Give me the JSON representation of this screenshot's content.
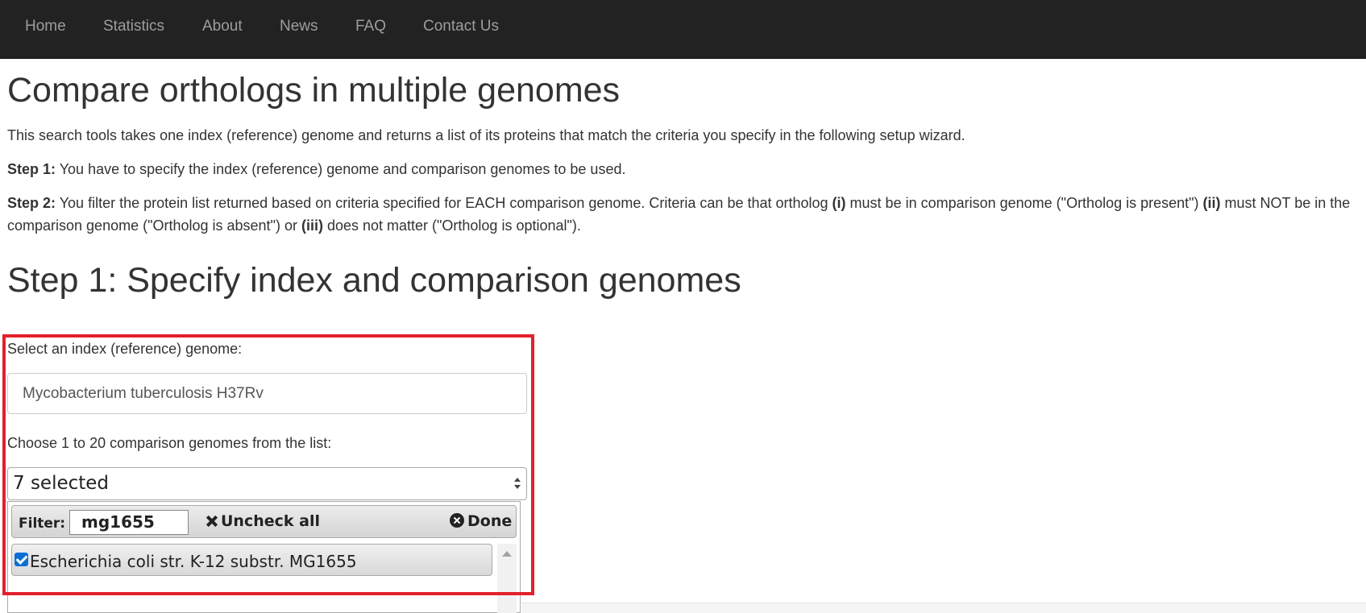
{
  "nav": {
    "items": [
      "Home",
      "Statistics",
      "About",
      "News",
      "FAQ",
      "Contact Us"
    ],
    "background": "#222222",
    "text_color": "#9d9d9d"
  },
  "page": {
    "title": "Compare orthologs in multiple genomes",
    "intro": "This search tools takes one index (reference) genome and returns a list of its proteins that match the criteria you specify in the following setup wizard.",
    "step1": {
      "label": "Step 1:",
      "text": " You have to specify the index (reference) genome and comparison genomes to be used."
    },
    "step2": {
      "label": "Step 2:",
      "t1": " You filter the protein list returned based on criteria specified for EACH comparison genome. Criteria can be that ortholog ",
      "b1": "(i)",
      "t2": " must be in comparison genome (\"Ortholog is present\") ",
      "b2": "(ii)",
      "t3": " must NOT be in the comparison genome (\"Ortholog is absent\") or ",
      "b3": "(iii)",
      "t4": " does not matter (\"Ortholog is optional\")."
    },
    "step1_heading": "Step 1: Specify index and comparison genomes"
  },
  "form": {
    "index_label": "Select an index (reference) genome:",
    "index_value": "Mycobacterium tuberculosis H37Rv",
    "comparison_label": "Choose 1 to 20 comparison genomes from the list:",
    "multiselect": {
      "button_text": "7 selected",
      "filter_label": "Filter:",
      "filter_value": "mg1655",
      "uncheck_all": "Uncheck all",
      "done": "Done",
      "items": [
        {
          "label": "Escherichia coli str. K-12 substr. MG1655",
          "checked": true
        }
      ]
    }
  },
  "colors": {
    "highlight": "#e3202c",
    "checkbox": "#0b6fd6"
  }
}
